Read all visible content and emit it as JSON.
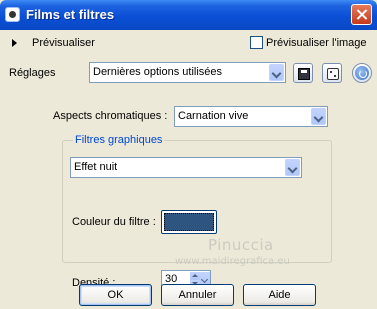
{
  "window": {
    "title": "Films et filtres"
  },
  "preview": {
    "toggle_label": "Prévisualiser",
    "checkbox_label": "Prévisualiser l'image",
    "checkbox_checked": false
  },
  "settings": {
    "label": "Réglages",
    "selected_value": "Dernières options utilisées"
  },
  "chromatic": {
    "label": "Aspects chromatiques :",
    "selected_value": "Carnation vive"
  },
  "graphic_filters": {
    "group_label": "Filtres graphiques",
    "selected_value": "Effet nuit",
    "filter_color_label": "Couleur du filtre :",
    "filter_color": "#2e5480",
    "density_label": "Densité :",
    "density_value": "30",
    "density_fraction": 0.3
  },
  "buttons": {
    "ok": "OK",
    "cancel": "Annuler",
    "help": "Aide"
  },
  "watermark": {
    "name": "Pinuccia",
    "url": "www.maidiregrafica.eu"
  }
}
